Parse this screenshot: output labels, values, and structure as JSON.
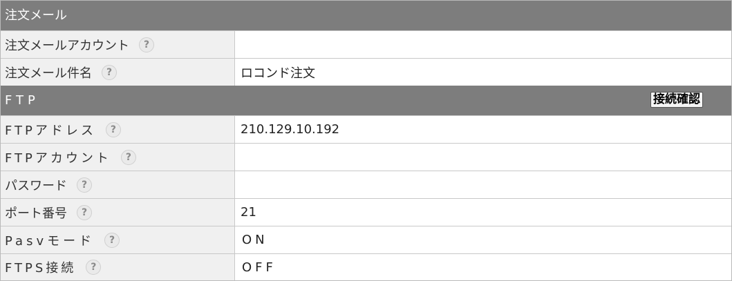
{
  "sections": {
    "order_mail": {
      "title": "注文メール"
    },
    "ftp": {
      "title": "FTP",
      "connect_label": "接続確認"
    }
  },
  "fields": {
    "order_mail_account": {
      "label": "注文メールアカウント",
      "value": ""
    },
    "order_mail_subject": {
      "label": "注文メール件名",
      "value": "ロコンド注文"
    },
    "ftp_address": {
      "label": "FTPアドレス",
      "value": "210.129.10.192"
    },
    "ftp_account": {
      "label": "FTPアカウント",
      "value": ""
    },
    "password": {
      "label": "パスワード",
      "value": ""
    },
    "port": {
      "label": "ポート番号",
      "value": "21"
    },
    "pasv_mode": {
      "label": "Pasvモード",
      "value": "ON"
    },
    "ftps": {
      "label": "FTPS接続",
      "value": "OFF"
    }
  },
  "help_icon_glyph": "?"
}
